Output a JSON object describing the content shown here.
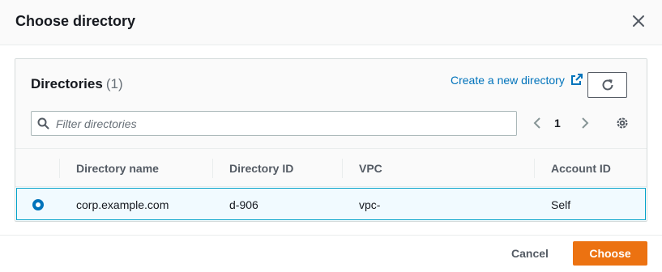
{
  "modal": {
    "title": "Choose directory",
    "close_icon": "close-icon"
  },
  "directories": {
    "title": "Directories",
    "count": "(1)",
    "create_link": "Create a new directory",
    "external_icon": "external-link-icon",
    "refresh_icon": "refresh-icon"
  },
  "filter": {
    "placeholder": "Filter directories",
    "value": "",
    "search_icon": "search-icon"
  },
  "pagination": {
    "prev_icon": "chevron-left-icon",
    "current_page": "1",
    "next_icon": "chevron-right-icon",
    "settings_icon": "gear-icon"
  },
  "table": {
    "columns": [
      "Directory name",
      "Directory ID",
      "VPC",
      "Account ID"
    ],
    "rows": [
      {
        "selected": true,
        "directory_name": "corp.example.com",
        "directory_id": "d-906",
        "vpc": "vpc-",
        "account_id": "Self"
      }
    ]
  },
  "footer": {
    "cancel_label": "Cancel",
    "choose_label": "Choose"
  },
  "colors": {
    "primary_button": "#ec7211",
    "link": "#0073bb",
    "selected_row_bg": "#f1faff",
    "selected_row_border": "#00a1c9"
  }
}
